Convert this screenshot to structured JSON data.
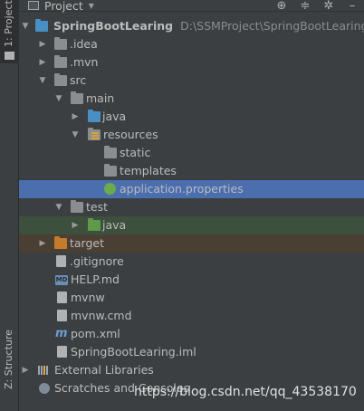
{
  "sidebar": {
    "project_tab": "1: Project",
    "structure_tab": "Z: Structure"
  },
  "header": {
    "title": "Project",
    "tools": [
      "target-icon",
      "collapse-icon",
      "gear-icon",
      "hide-icon"
    ]
  },
  "tree": {
    "root": {
      "name": "SpringBootLearing",
      "path": "D:\\SSMProject\\SpringBootLearing"
    },
    "idea": ".idea",
    "mvn": ".mvn",
    "src": "src",
    "main": "main",
    "main_java": "java",
    "resources": "resources",
    "static": "static",
    "templates": "templates",
    "app_props": "application.properties",
    "test": "test",
    "test_java": "java",
    "target": "target",
    "gitignore": ".gitignore",
    "help": "HELP.md",
    "help_badge": "MD",
    "mvnw": "mvnw",
    "mvnw_cmd": "mvnw.cmd",
    "pom": "pom.xml",
    "iml": "SpringBootLearing.iml",
    "external_libraries": "External Libraries",
    "scratches": "Scratches and Consoles"
  },
  "watermark": "https://blog.csdn.net/qq_43538170",
  "colors": {
    "background": "#3c3f41",
    "selection": "#4b6eaf",
    "test_highlight": "#3d4f3d",
    "target_highlight": "#4a3f33"
  }
}
